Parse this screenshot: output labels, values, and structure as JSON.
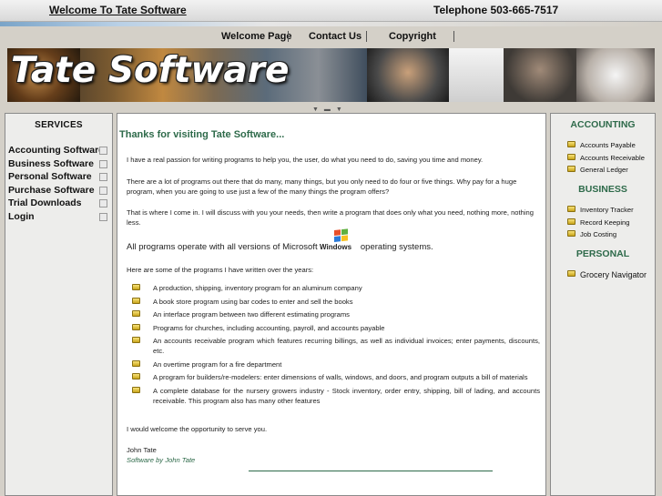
{
  "header": {
    "welcome": "Welcome To Tate Software",
    "phone": "Telephone 503-665-7517"
  },
  "nav": {
    "items": [
      "Welcome Page",
      "Contact Us",
      "Copyright"
    ]
  },
  "banner": {
    "title": "Tate Software"
  },
  "services": {
    "title": "SERVICES",
    "items": [
      "Accounting Software",
      "Business Software",
      "Personal Software",
      "Purchase Software",
      "Trial Downloads",
      "Login"
    ]
  },
  "main": {
    "heading": "Thanks for visiting Tate Software...",
    "p1": "I have a real passion for writing programs to help you, the user, do what you need to do, saving you time and money.",
    "p2": "There are a lot of programs out there that do many, many things, but you only need to do four or five things. Why pay for a huge program, when you are going to use just a few of the many things the program offers?",
    "p3": "That is where I come in. I will discuss with you your needs, then write a program that does only what you need, nothing more, nothing less.",
    "windows_pre": "All programs operate with all versions of Microsoft",
    "windows_logo_text": "Windows",
    "windows_post": "operating systems.",
    "list_intro": "Here are some of the programs I have written over the years:",
    "programs": [
      "A production, shipping, inventory program for an aluminum company",
      "A book store program using bar codes to enter and sell the books",
      "An interface program between two different estimating programs",
      "Programs for churches, including accounting, payroll, and accounts payable",
      "An accounts receivable program which features recurring billings, as well as individual invoices; enter payments, discounts, etc.",
      "An overtime program for a fire department",
      "A program for builders/re-modelers: enter dimensions of walls, windows, and doors, and program outputs a bill of materials",
      "A complete database for the nursery growers industry - Stock inventory, order entry, shipping, bill of lading, and accounts receivable. This program also has many other features"
    ],
    "closing": "I would welcome the opportunity to serve you.",
    "signature_name": "John Tate",
    "signature_title": "Software by John Tate"
  },
  "sidebar": {
    "accounting_title": "ACCOUNTING",
    "accounting": [
      "Accounts Payable",
      "Accounts Receivable",
      "General Ledger"
    ],
    "business_title": "BUSINESS",
    "business": [
      "Inventory Tracker",
      "Record Keeping",
      "Job Costing"
    ],
    "personal_title": "PERSONAL",
    "personal": [
      "Grocery Navigator"
    ]
  },
  "colors": {
    "accent_green": "#2e6a4a",
    "bullet_yellow": "#e8c840",
    "chrome_gray": "#d4d0c8"
  }
}
